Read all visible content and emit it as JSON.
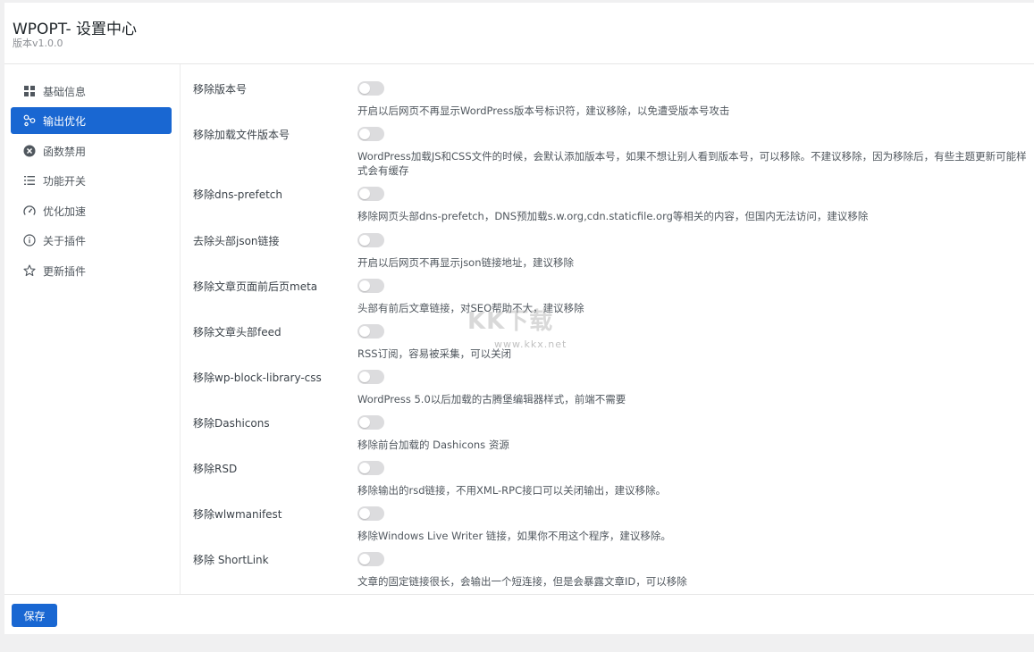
{
  "header": {
    "title": "WPOPT- 设置中心",
    "version": "版本v1.0.0"
  },
  "sidebar": {
    "items": [
      {
        "label": "基础信息",
        "icon": "grid-icon",
        "active": false
      },
      {
        "label": "输出优化",
        "icon": "share-nodes-icon",
        "active": true
      },
      {
        "label": "函数禁用",
        "icon": "ban-circle-icon",
        "active": false
      },
      {
        "label": "功能开关",
        "icon": "list-icon",
        "active": false
      },
      {
        "label": "优化加速",
        "icon": "speedometer-icon",
        "active": false
      },
      {
        "label": "关于插件",
        "icon": "info-icon",
        "active": false
      },
      {
        "label": "更新插件",
        "icon": "star-icon",
        "active": false
      }
    ]
  },
  "options": [
    {
      "label": "移除版本号",
      "enabled": false,
      "desc": "开启以后网页不再显示WordPress版本号标识符，建议移除，以免遭受版本号攻击"
    },
    {
      "label": "移除加载文件版本号",
      "enabled": false,
      "desc": "WordPress加载JS和CSS文件的时候，会默认添加版本号，如果不想让别人看到版本号，可以移除。不建议移除，因为移除后，有些主题更新可能样式会有缓存"
    },
    {
      "label": "移除dns-prefetch",
      "enabled": false,
      "desc": "移除网页头部dns-prefetch，DNS预加载s.w.org,cdn.staticfile.org等相关的内容，但国内无法访问，建议移除"
    },
    {
      "label": "去除头部json链接",
      "enabled": false,
      "desc": "开启以后网页不再显示json链接地址，建议移除"
    },
    {
      "label": "移除文章页面前后页meta",
      "enabled": false,
      "desc": "头部有前后文章链接，对SEO帮助不大，建议移除"
    },
    {
      "label": "移除文章头部feed",
      "enabled": false,
      "desc": "RSS订阅，容易被采集，可以关闭"
    },
    {
      "label": "移除wp-block-library-css",
      "enabled": false,
      "desc": "WordPress 5.0以后加载的古腾堡编辑器样式，前端不需要"
    },
    {
      "label": "移除Dashicons",
      "enabled": false,
      "desc": "移除前台加载的 Dashicons 资源"
    },
    {
      "label": "移除RSD",
      "enabled": false,
      "desc": "移除输出的rsd链接，不用XML-RPC接口可以关闭输出，建议移除。"
    },
    {
      "label": "移除wlwmanifest",
      "enabled": false,
      "desc": "移除Windows Live Writer 链接，如果你不用这个程序，建议移除。"
    },
    {
      "label": "移除 ShortLink",
      "enabled": false,
      "desc": "文章的固定链接很长，会输出一个短连接，但是会暴露文章ID，可以移除"
    }
  ],
  "footer": {
    "save_label": "保存"
  },
  "watermark": {
    "logo": "KK下载",
    "url": "www.kkx.net"
  },
  "colors": {
    "accent": "#1967d2",
    "toggle_off": "#dcdcde",
    "page_bg": "#f0f0f1"
  }
}
